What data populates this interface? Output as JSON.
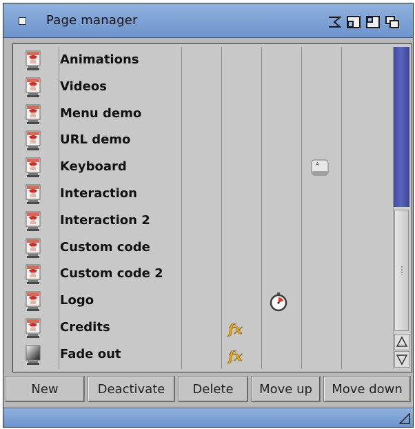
{
  "window": {
    "title": "Page manager"
  },
  "pages": [
    {
      "name": "Animations",
      "icon": "page-thumbnail-icon"
    },
    {
      "name": "Videos",
      "icon": "page-thumbnail-icon"
    },
    {
      "name": "Menu demo",
      "icon": "page-thumbnail-icon"
    },
    {
      "name": "URL demo",
      "icon": "page-thumbnail-icon"
    },
    {
      "name": "Keyboard",
      "icon": "page-thumbnail-icon",
      "flags": [
        "keyboard-icon"
      ]
    },
    {
      "name": "Interaction",
      "icon": "page-thumbnail-icon"
    },
    {
      "name": "Interaction 2",
      "icon": "page-thumbnail-icon"
    },
    {
      "name": "Custom code",
      "icon": "page-thumbnail-icon"
    },
    {
      "name": "Custom code 2",
      "icon": "page-thumbnail-icon"
    },
    {
      "name": "Logo",
      "icon": "page-thumbnail-icon",
      "flags": [
        "timer-icon"
      ]
    },
    {
      "name": "Credits",
      "icon": "page-thumbnail-icon",
      "flags": [
        "fx-icon"
      ]
    },
    {
      "name": "Fade out",
      "icon": "gradient-thumbnail-icon",
      "flags": [
        "fx-icon"
      ]
    }
  ],
  "buttons": {
    "new": "New",
    "deactivate": "Deactivate",
    "delete": "Delete",
    "move_up": "Move up",
    "move_down": "Move down"
  },
  "colors": {
    "titlebar": "#7aa0d4",
    "scroll_track": "#4a55b0",
    "list_background": "#c8c8c8"
  }
}
